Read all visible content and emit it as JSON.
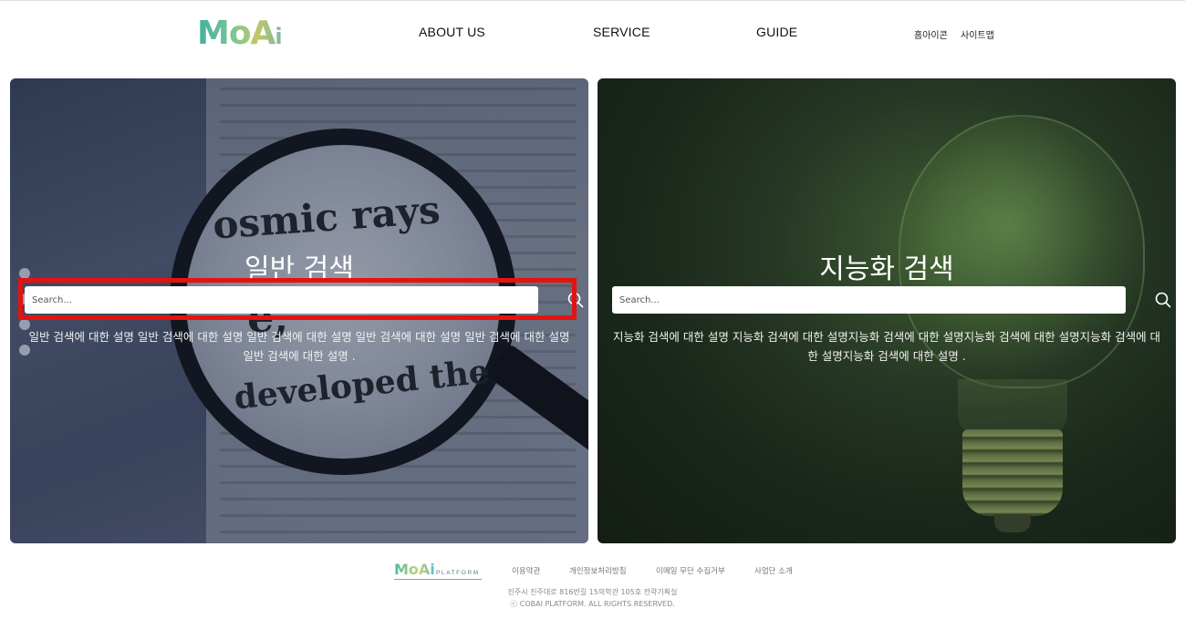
{
  "header": {
    "logo": {
      "text_main": "MoA",
      "text_small": "i"
    },
    "nav": [
      {
        "label": "ABOUT US"
      },
      {
        "label": "SERVICE"
      },
      {
        "label": "GUIDE"
      }
    ],
    "utility": {
      "home_icon_label": "홈아이콘",
      "sitemap_label": "사이트맵"
    }
  },
  "general_search": {
    "title": "일반 검색",
    "placeholder": "Search...",
    "description": "일반 검색에 대한 설명 일반 검색에 대한 설명 일반 검색에 대한 설명 일반 검색에 대한 설명 일반 검색에 대한 설명 일반 검색에 대한 설명 .",
    "magnifier_text": [
      "osmic rays",
      "e,”",
      "developed the"
    ],
    "highlight_color": "#e3140f"
  },
  "intelligent_search": {
    "title": "지능화 검색",
    "placeholder": "Search...",
    "description": "지능화 검색에 대한 설명 지능화 검색에 대한 설명지능화 검색에 대한 설명지능화 검색에 대한 설명지능화 검색에 대한 설명지능화 검색에 대한 설명 ."
  },
  "footer": {
    "logo_main": "MoAi",
    "logo_sub": "PLATFORM",
    "links": [
      {
        "label": "이용약관"
      },
      {
        "label": "개인정보처리방침"
      },
      {
        "label": "이메일 무단 수집거부"
      },
      {
        "label": "사업단 소개"
      }
    ],
    "address": "진주시 진주대로 816번길 15의학관 105호 전략기획실",
    "copyright": "ⓒ COBAI PLATFORM. ALL RIGHTS RESERVED."
  },
  "icons": {
    "search": "search-icon"
  }
}
